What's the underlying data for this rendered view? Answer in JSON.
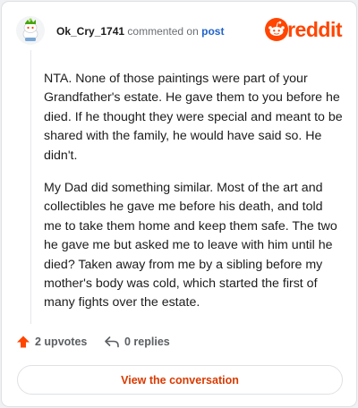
{
  "header": {
    "username": "Ok_Cry_1741",
    "commented_on_text": "commented on",
    "post_link": "post",
    "brand_wordmark": "reddit",
    "brand_color": "#ff4500",
    "avatar_icon": "snoo-avatar-icon"
  },
  "comment": {
    "paragraphs": [
      "NTA. None of those paintings were part of your Grandfather's estate. He gave them to you before he died. If he thought they were special and meant to be shared with the family, he would have said so. He didn't.",
      "My Dad did something similar. Most of the art and collectibles he gave me before his death, and told me to take them home and keep them safe. The two he gave me but asked me to leave with him until he died? Taken away from me by a sibling before my mother's body was cold, which started the first of many fights over the estate."
    ]
  },
  "actions": {
    "upvotes_label": "2 upvotes",
    "replies_label": "0 replies",
    "upvote_icon": "upvote-arrow-icon",
    "reply_icon": "reply-arrow-icon"
  },
  "cta": {
    "view_conversation_label": "View the conversation"
  }
}
